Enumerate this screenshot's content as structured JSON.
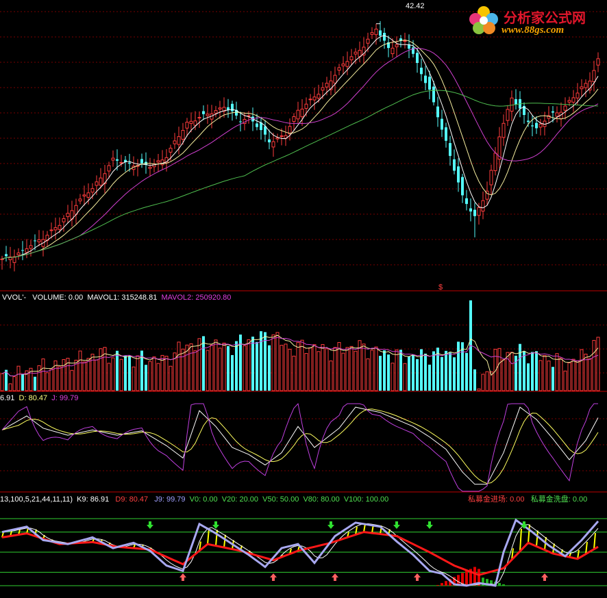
{
  "logo": {
    "title": "分析家公式网",
    "url": "www.88gs.com"
  },
  "colors": {
    "bg": "#000000",
    "up": "#ff3c3c",
    "down": "#54fcfc",
    "grid": "#7a0000",
    "sep": "#c00000",
    "ma_white": "#ffffff",
    "ma_yellow": "#f8f0a0",
    "ma_magenta": "#d040d0",
    "ma_green": "#50c050"
  },
  "main": {
    "high_label": "42.42",
    "marker": "$"
  },
  "vol_header": {
    "name": "VVOL'-",
    "volume": "VOLUME: 0.00",
    "mavol1": "MAVOL1: 315248.81",
    "mavol2": "MAVOL2: 250920.80"
  },
  "kdj_header": {
    "k": "6.91",
    "d": "D: 80.47",
    "j": "J: 99.79"
  },
  "ind_header": {
    "params": "13,100,5,21,44,11,11)",
    "k9": "K9: 86.91",
    "d9": "D9: 80.47",
    "j9": "J9: 99.79",
    "v0": "V0: 0.00",
    "v20": "V20: 20.00",
    "v50": "V50: 50.00",
    "v80": "V80: 80.00",
    "v100": "V100: 100.00",
    "enter": "私募金进场: 0.00",
    "wash": "私募金洗盘: 0.00"
  },
  "chart_data": [
    {
      "type": "candlestick",
      "price_anchors": [
        [
          0,
          23.5
        ],
        [
          5,
          24.2
        ],
        [
          10,
          25.3
        ],
        [
          14,
          26.3
        ],
        [
          18,
          28.0
        ],
        [
          22,
          29.2
        ],
        [
          27,
          31.5
        ],
        [
          31,
          31.2
        ],
        [
          36,
          31.0
        ],
        [
          40,
          31.8
        ],
        [
          45,
          34.5
        ],
        [
          49,
          35.0
        ],
        [
          54,
          35.8
        ],
        [
          58,
          34.7
        ],
        [
          60,
          35.0
        ],
        [
          65,
          33.0
        ],
        [
          69,
          33.5
        ],
        [
          72,
          35.5
        ],
        [
          77,
          36.8
        ],
        [
          82,
          38.8
        ],
        [
          88,
          40.7
        ],
        [
          91,
          42.0
        ],
        [
          94,
          40.5
        ],
        [
          98,
          41.0
        ],
        [
          100,
          40.0
        ],
        [
          104,
          37.0
        ],
        [
          108,
          33.0
        ],
        [
          112,
          28.5
        ],
        [
          115,
          27.0
        ],
        [
          118,
          29.0
        ],
        [
          121,
          33.5
        ],
        [
          124,
          36.5
        ],
        [
          127,
          35.0
        ],
        [
          130,
          34.0
        ],
        [
          133,
          35.0
        ],
        [
          136,
          35.5
        ],
        [
          139,
          36.5
        ],
        [
          143,
          38.0
        ],
        [
          145,
          39.5
        ]
      ],
      "high_value": 42.42,
      "low_value": 25.3,
      "ylim": [
        22.5,
        43.5
      ],
      "moving_averages": [
        {
          "period": 5,
          "color": "#ffffff"
        },
        {
          "period": 10,
          "color": "#f8f0a0"
        },
        {
          "period": 20,
          "color": "#d040d0"
        },
        {
          "period": 60,
          "color": "#50c050"
        }
      ]
    },
    {
      "type": "bar",
      "name": "volume",
      "vol_anchors": [
        [
          0,
          15
        ],
        [
          8,
          24
        ],
        [
          14,
          30
        ],
        [
          20,
          36
        ],
        [
          24,
          42
        ],
        [
          28,
          38
        ],
        [
          32,
          36
        ],
        [
          40,
          34
        ],
        [
          44,
          50
        ],
        [
          50,
          54
        ],
        [
          55,
          48
        ],
        [
          60,
          58
        ],
        [
          66,
          62
        ],
        [
          70,
          46
        ],
        [
          74,
          50
        ],
        [
          80,
          44
        ],
        [
          86,
          50
        ],
        [
          92,
          42
        ],
        [
          98,
          38
        ],
        [
          104,
          40
        ],
        [
          110,
          44
        ],
        [
          113,
          52
        ],
        [
          114,
          100
        ],
        [
          115,
          20
        ],
        [
          116,
          4
        ],
        [
          120,
          40
        ],
        [
          126,
          44
        ],
        [
          132,
          36
        ],
        [
          138,
          30
        ],
        [
          142,
          42
        ],
        [
          145,
          54
        ]
      ],
      "mavol_periods": [
        5,
        10
      ]
    },
    {
      "type": "line",
      "name": "KDJ",
      "k_anchors": [
        [
          0,
          70
        ],
        [
          6,
          86
        ],
        [
          10,
          72
        ],
        [
          16,
          64
        ],
        [
          22,
          70
        ],
        [
          28,
          64
        ],
        [
          34,
          69
        ],
        [
          40,
          52
        ],
        [
          44,
          38
        ],
        [
          48,
          92
        ],
        [
          52,
          74
        ],
        [
          56,
          50
        ],
        [
          60,
          42
        ],
        [
          64,
          30
        ],
        [
          68,
          44
        ],
        [
          72,
          74
        ],
        [
          76,
          50
        ],
        [
          82,
          72
        ],
        [
          86,
          96
        ],
        [
          92,
          90
        ],
        [
          96,
          82
        ],
        [
          100,
          74
        ],
        [
          104,
          62
        ],
        [
          108,
          48
        ],
        [
          112,
          22
        ],
        [
          115,
          8
        ],
        [
          118,
          8
        ],
        [
          122,
          44
        ],
        [
          126,
          96
        ],
        [
          130,
          82
        ],
        [
          134,
          60
        ],
        [
          138,
          36
        ],
        [
          142,
          58
        ],
        [
          145,
          84
        ]
      ],
      "ylim": [
        0,
        100
      ]
    },
    {
      "type": "line",
      "name": "signal-oscillator",
      "levels": [
        0,
        20,
        50,
        80,
        100
      ],
      "lavender_anchors": [
        [
          0,
          80
        ],
        [
          6,
          88
        ],
        [
          10,
          68
        ],
        [
          16,
          62
        ],
        [
          22,
          72
        ],
        [
          27,
          56
        ],
        [
          32,
          64
        ],
        [
          36,
          52
        ],
        [
          40,
          30
        ],
        [
          44,
          22
        ],
        [
          48,
          92
        ],
        [
          52,
          78
        ],
        [
          56,
          62
        ],
        [
          60,
          46
        ],
        [
          64,
          28
        ],
        [
          68,
          56
        ],
        [
          72,
          62
        ],
        [
          76,
          34
        ],
        [
          81,
          74
        ],
        [
          86,
          94
        ],
        [
          92,
          88
        ],
        [
          96,
          66
        ],
        [
          100,
          46
        ],
        [
          104,
          22
        ],
        [
          107,
          18
        ],
        [
          110,
          2
        ],
        [
          113,
          0
        ],
        [
          116,
          4
        ],
        [
          120,
          0
        ],
        [
          122,
          50
        ],
        [
          125,
          98
        ],
        [
          129,
          80
        ],
        [
          133,
          60
        ],
        [
          137,
          44
        ],
        [
          141,
          68
        ],
        [
          145,
          96
        ]
      ],
      "red_anchors": [
        [
          0,
          72
        ],
        [
          6,
          78
        ],
        [
          14,
          62
        ],
        [
          22,
          65
        ],
        [
          28,
          58
        ],
        [
          36,
          54
        ],
        [
          44,
          32
        ],
        [
          50,
          62
        ],
        [
          58,
          52
        ],
        [
          66,
          38
        ],
        [
          72,
          52
        ],
        [
          80,
          64
        ],
        [
          88,
          80
        ],
        [
          96,
          74
        ],
        [
          104,
          50
        ],
        [
          110,
          30
        ],
        [
          116,
          16
        ],
        [
          122,
          26
        ],
        [
          128,
          64
        ],
        [
          134,
          48
        ],
        [
          140,
          40
        ],
        [
          145,
          58
        ]
      ],
      "buy_arrows_x": [
        44,
        66,
        81,
        101,
        132
      ],
      "sell_arrows_x": [
        36,
        52,
        80,
        96,
        104,
        127
      ]
    }
  ]
}
